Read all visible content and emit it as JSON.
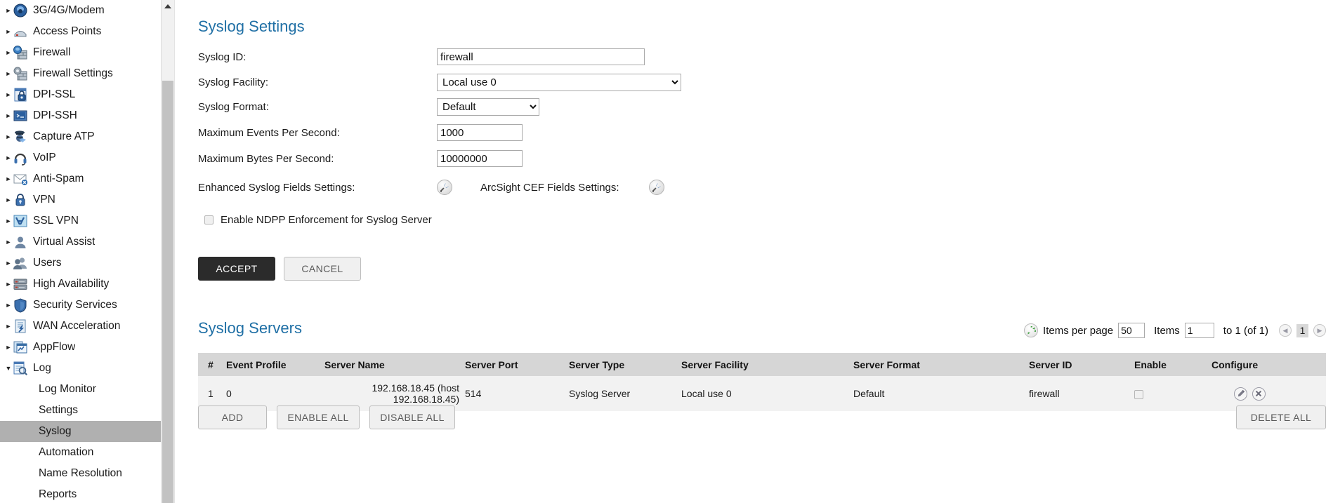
{
  "sidebar": {
    "items": [
      {
        "label": "3G/4G/Modem",
        "icon": "modem-icon",
        "expandable": true
      },
      {
        "label": "Access Points",
        "icon": "access-point-icon",
        "expandable": true
      },
      {
        "label": "Firewall",
        "icon": "firewall-icon",
        "expandable": true
      },
      {
        "label": "Firewall Settings",
        "icon": "firewall-settings-icon",
        "expandable": true
      },
      {
        "label": "DPI-SSL",
        "icon": "dpi-ssl-icon",
        "expandable": true
      },
      {
        "label": "DPI-SSH",
        "icon": "dpi-ssh-icon",
        "expandable": true
      },
      {
        "label": "Capture ATP",
        "icon": "capture-atp-icon",
        "expandable": true
      },
      {
        "label": "VoIP",
        "icon": "voip-icon",
        "expandable": true
      },
      {
        "label": "Anti-Spam",
        "icon": "anti-spam-icon",
        "expandable": true
      },
      {
        "label": "VPN",
        "icon": "vpn-icon",
        "expandable": true
      },
      {
        "label": "SSL VPN",
        "icon": "ssl-vpn-icon",
        "expandable": true
      },
      {
        "label": "Virtual Assist",
        "icon": "virtual-assist-icon",
        "expandable": true
      },
      {
        "label": "Users",
        "icon": "users-icon",
        "expandable": true
      },
      {
        "label": "High Availability",
        "icon": "high-availability-icon",
        "expandable": true
      },
      {
        "label": "Security Services",
        "icon": "security-services-icon",
        "expandable": true
      },
      {
        "label": "WAN Acceleration",
        "icon": "wan-acceleration-icon",
        "expandable": true
      },
      {
        "label": "AppFlow",
        "icon": "appflow-icon",
        "expandable": true
      },
      {
        "label": "Log",
        "icon": "log-icon",
        "expandable": true,
        "expanded": true
      }
    ],
    "sub_items": [
      {
        "label": "Log Monitor",
        "selected": false
      },
      {
        "label": "Settings",
        "selected": false
      },
      {
        "label": "Syslog",
        "selected": true
      },
      {
        "label": "Automation",
        "selected": false
      },
      {
        "label": "Name Resolution",
        "selected": false
      },
      {
        "label": "Reports",
        "selected": false
      }
    ],
    "selected_label": "Syslog",
    "selection_color": "#b0b0b0"
  },
  "settings": {
    "title": "Syslog Settings",
    "syslog_id_label": "Syslog ID:",
    "syslog_id_value": "firewall",
    "syslog_facility_label": "Syslog Facility:",
    "syslog_facility_value": "Local use 0",
    "syslog_format_label": "Syslog Format:",
    "syslog_format_value": "Default",
    "max_events_label": "Maximum Events Per Second:",
    "max_events_value": "1000",
    "max_bytes_label": "Maximum Bytes Per Second:",
    "max_bytes_value": "10000000",
    "enhanced_fields_label": "Enhanced Syslog Fields Settings:",
    "arcsight_fields_label": "ArcSight CEF Fields Settings:",
    "ndpp_checkbox_label": "Enable NDPP Enforcement for Syslog Server",
    "ndpp_checked": false,
    "accept_label": "ACCEPT",
    "cancel_label": "CANCEL"
  },
  "servers": {
    "title": "Syslog Servers",
    "pager": {
      "items_per_page_label": "Items per page",
      "items_per_page_value": "50",
      "items_label": "Items",
      "items_value": "1",
      "range_label": "to 1 (of 1)",
      "current_page": "1"
    },
    "columns": [
      "#",
      "Event Profile",
      "Server Name",
      "Server Port",
      "Server Type",
      "Server Facility",
      "Server Format",
      "Server ID",
      "Enable",
      "Configure"
    ],
    "rows": [
      {
        "num": "1",
        "event_profile": "0",
        "server_name": "192.168.18.45 (host 192.168.18.45)",
        "server_port": "514",
        "server_type": "Syslog Server",
        "server_facility": "Local use 0",
        "server_format": "Default",
        "server_id": "firewall",
        "enabled": false
      }
    ],
    "actions": {
      "add_label": "ADD",
      "enable_all_label": "ENABLE ALL",
      "disable_all_label": "DISABLE ALL",
      "delete_all_label": "DELETE ALL"
    }
  },
  "colors": {
    "heading": "#1f6fa5",
    "table_header_bg": "#d6d6d6",
    "table_row_bg": "#f2f2f2",
    "accept_bg": "#2b2b2b"
  }
}
